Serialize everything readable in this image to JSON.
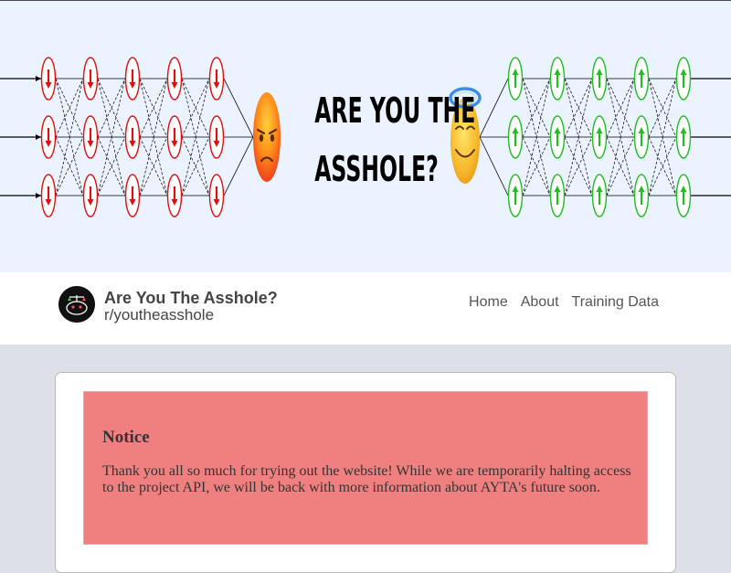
{
  "banner": {
    "title_line1": "ARE YOU THE",
    "title_line2": "ASSHOLE?",
    "left_emoji": "angry-face",
    "right_emoji": "smiling-face-with-halo",
    "colors": {
      "background": "#eaf3ff",
      "left_nodes": "#e01010",
      "right_nodes": "#1fbf1f"
    }
  },
  "header": {
    "logo_icon": "subreddit-snoo-scales-icon",
    "title": "Are You The Asshole?",
    "subreddit": "r/youtheasshole"
  },
  "nav": {
    "links": [
      "Home",
      "About",
      "Training Data"
    ]
  },
  "notice": {
    "title": "Notice",
    "body": "Thank you all so much for trying out the website! While we are temporarily halting access to the project API, we will be back with more information about AYTA's future soon.",
    "colors": {
      "background": "#f08080"
    }
  }
}
